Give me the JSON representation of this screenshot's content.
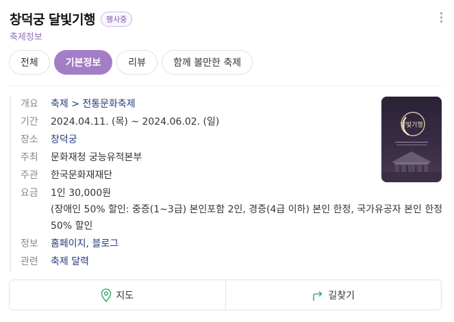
{
  "header": {
    "title": "창덕궁 달빛기행",
    "badge": "행사중",
    "subtitle": "축제정보"
  },
  "tabs": [
    {
      "label": "전체",
      "active": false
    },
    {
      "label": "기본정보",
      "active": true
    },
    {
      "label": "리뷰",
      "active": false
    },
    {
      "label": "함께 볼만한 축제",
      "active": false
    }
  ],
  "info": {
    "overview": {
      "label": "개요",
      "value": "축제 > 전통문화축제"
    },
    "period": {
      "label": "기간",
      "value": "2024.04.11. (목) ~  2024.06.02. (일)"
    },
    "place": {
      "label": "장소",
      "value": "창덕궁"
    },
    "host": {
      "label": "주최",
      "value": "문화재청 궁능유적본부"
    },
    "organizer": {
      "label": "주관",
      "value": "한국문화재재단"
    },
    "fee": {
      "label": "요금",
      "value": "1인 30,000원",
      "note": "(장애인 50% 할인: 중증(1~3급) 본인포함 2인, 경증(4급 이하) 본인 한정, 국가유공자 본인 한정 50% 할인"
    },
    "links": {
      "label": "정보",
      "homepage": "홈페이지",
      "separator": ", ",
      "blog": "블로그"
    },
    "related": {
      "label": "관련",
      "value": "축제 달력"
    }
  },
  "poster": {
    "title": "달빛기행"
  },
  "actions": {
    "map": "지도",
    "directions": "길찾기"
  },
  "colors": {
    "accent": "#a37ec7",
    "link": "#233a7a",
    "map_icon": "#3fae6f"
  }
}
